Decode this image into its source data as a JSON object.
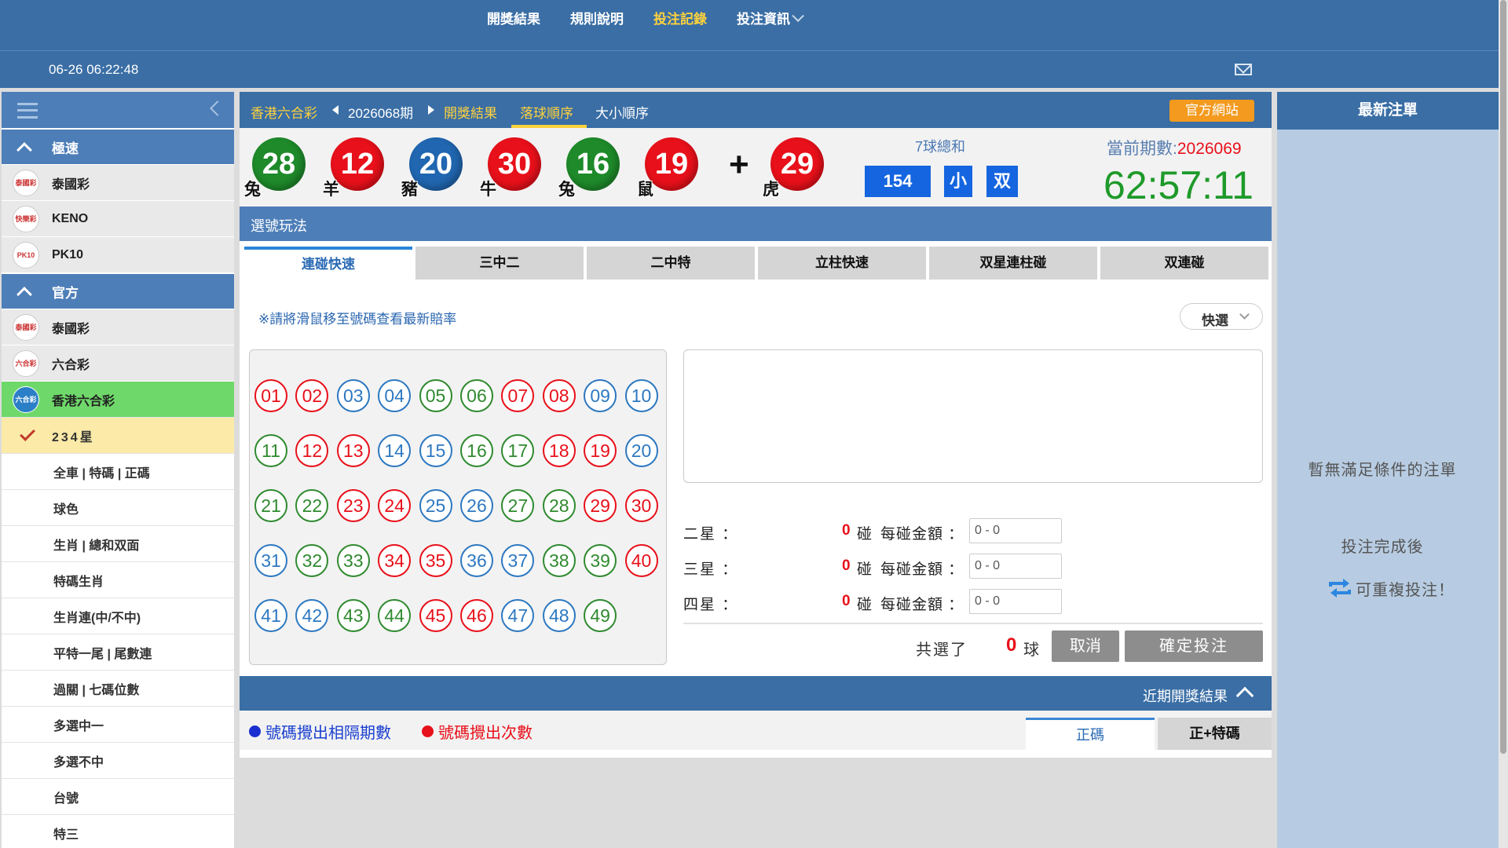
{
  "topnav": {
    "items": [
      "開獎結果",
      "規則說明",
      "投注記錄",
      "投注資訊"
    ],
    "active_index": 2
  },
  "infobar": {
    "clock": "06-26 06:22:48"
  },
  "sidebar": {
    "groups": {
      "speed": "極速",
      "official": "官方"
    },
    "speed_games": [
      {
        "name": "泰國彩",
        "logo": "泰國彩"
      },
      {
        "name": "KENO",
        "logo": "快樂彩"
      },
      {
        "name": "PK10",
        "logo": "PK10"
      }
    ],
    "official_games": [
      {
        "name": "泰國彩",
        "logo": "泰國彩"
      },
      {
        "name": "六合彩",
        "logo": "六合彩"
      },
      {
        "name": "香港六合彩",
        "logo": "六合彩"
      }
    ],
    "checked_item": "234星",
    "sub_items": [
      "全車 | 特碼 | 正碼",
      "球色",
      "生肖 | 總和双面",
      "特碼生肖",
      "生肖連(中/不中)",
      "平特一尾 | 尾數連",
      "過關 | 七碼位數",
      "多選中一",
      "多選不中",
      "台號",
      "特三"
    ]
  },
  "breadcrumb": {
    "game": "香港六合彩",
    "period": "2026068期",
    "results": "開獎結果",
    "drop_order": "落球順序",
    "size_order": "大小順序",
    "official_site": "官方網站"
  },
  "draw": {
    "balls": [
      {
        "num": "28",
        "color": "green",
        "zodiac": "兔"
      },
      {
        "num": "12",
        "color": "red",
        "zodiac": "羊"
      },
      {
        "num": "20",
        "color": "blue",
        "zodiac": "豬"
      },
      {
        "num": "30",
        "color": "red",
        "zodiac": "牛"
      },
      {
        "num": "16",
        "color": "green",
        "zodiac": "兔"
      },
      {
        "num": "19",
        "color": "red",
        "zodiac": "鼠"
      }
    ],
    "special": {
      "num": "29",
      "color": "red",
      "zodiac": "虎"
    },
    "plus": "+",
    "sum_label": "7球總和",
    "sum_value": "154",
    "size": "小",
    "parity": "双",
    "period_label": "當前期數:",
    "period_num": "2026069",
    "countdown": "62:57:11"
  },
  "section_title": "選號玩法",
  "tabs": [
    "連碰快速",
    "三中二",
    "二中特",
    "立柱快速",
    "双星連柱碰",
    "双連碰"
  ],
  "hint": "※請將滑鼠移至號碼查看最新賠率",
  "quick_select": "快選",
  "numbers": [
    {
      "n": "01",
      "c": "red"
    },
    {
      "n": "02",
      "c": "red"
    },
    {
      "n": "03",
      "c": "blue"
    },
    {
      "n": "04",
      "c": "blue"
    },
    {
      "n": "05",
      "c": "green"
    },
    {
      "n": "06",
      "c": "green"
    },
    {
      "n": "07",
      "c": "red"
    },
    {
      "n": "08",
      "c": "red"
    },
    {
      "n": "09",
      "c": "blue"
    },
    {
      "n": "10",
      "c": "blue"
    },
    {
      "n": "11",
      "c": "green"
    },
    {
      "n": "12",
      "c": "red"
    },
    {
      "n": "13",
      "c": "red"
    },
    {
      "n": "14",
      "c": "blue"
    },
    {
      "n": "15",
      "c": "blue"
    },
    {
      "n": "16",
      "c": "green"
    },
    {
      "n": "17",
      "c": "green"
    },
    {
      "n": "18",
      "c": "red"
    },
    {
      "n": "19",
      "c": "red"
    },
    {
      "n": "20",
      "c": "blue"
    },
    {
      "n": "21",
      "c": "green"
    },
    {
      "n": "22",
      "c": "green"
    },
    {
      "n": "23",
      "c": "red"
    },
    {
      "n": "24",
      "c": "red"
    },
    {
      "n": "25",
      "c": "blue"
    },
    {
      "n": "26",
      "c": "blue"
    },
    {
      "n": "27",
      "c": "green"
    },
    {
      "n": "28",
      "c": "green"
    },
    {
      "n": "29",
      "c": "red"
    },
    {
      "n": "30",
      "c": "red"
    },
    {
      "n": "31",
      "c": "blue"
    },
    {
      "n": "32",
      "c": "green"
    },
    {
      "n": "33",
      "c": "green"
    },
    {
      "n": "34",
      "c": "red"
    },
    {
      "n": "35",
      "c": "red"
    },
    {
      "n": "36",
      "c": "blue"
    },
    {
      "n": "37",
      "c": "blue"
    },
    {
      "n": "38",
      "c": "green"
    },
    {
      "n": "39",
      "c": "green"
    },
    {
      "n": "40",
      "c": "red"
    },
    {
      "n": "41",
      "c": "blue"
    },
    {
      "n": "42",
      "c": "blue"
    },
    {
      "n": "43",
      "c": "green"
    },
    {
      "n": "44",
      "c": "green"
    },
    {
      "n": "45",
      "c": "red"
    },
    {
      "n": "46",
      "c": "red"
    },
    {
      "n": "47",
      "c": "blue"
    },
    {
      "n": "48",
      "c": "blue"
    },
    {
      "n": "49",
      "c": "green"
    }
  ],
  "stars": [
    {
      "label": "二星 ：",
      "count": "0",
      "unit": "碰",
      "amount_label": "每碰金額 ：",
      "amount": "0 - 0"
    },
    {
      "label": "三星 ：",
      "count": "0",
      "unit": "碰",
      "amount_label": "每碰金額 ：",
      "amount": "0 - 0"
    },
    {
      "label": "四星 ：",
      "count": "0",
      "unit": "碰",
      "amount_label": "每碰金額 ：",
      "amount": "0 - 0"
    }
  ],
  "totals": {
    "label": "共選了",
    "count": "0",
    "unit": "球"
  },
  "buttons": {
    "cancel": "取消",
    "confirm": "確定投注"
  },
  "recent": {
    "title": "近期開獎結果",
    "legend_interval": "號碼攪出相隔期數",
    "legend_count": "號碼攪出次數",
    "tab_main": "正碼",
    "tab_special": "正+特碼"
  },
  "right_panel": {
    "title": "最新注單",
    "empty": "暫無滿足條件的注單",
    "after": "投注完成後",
    "repeat": "可重複投注！"
  },
  "colors": {
    "primary": "#3a6ea5",
    "accent": "#ffd23c",
    "ball_red": "#e8101a",
    "ball_green": "#1e8a2a",
    "ball_blue": "#2066b0",
    "countdown": "#1e9a2a"
  }
}
